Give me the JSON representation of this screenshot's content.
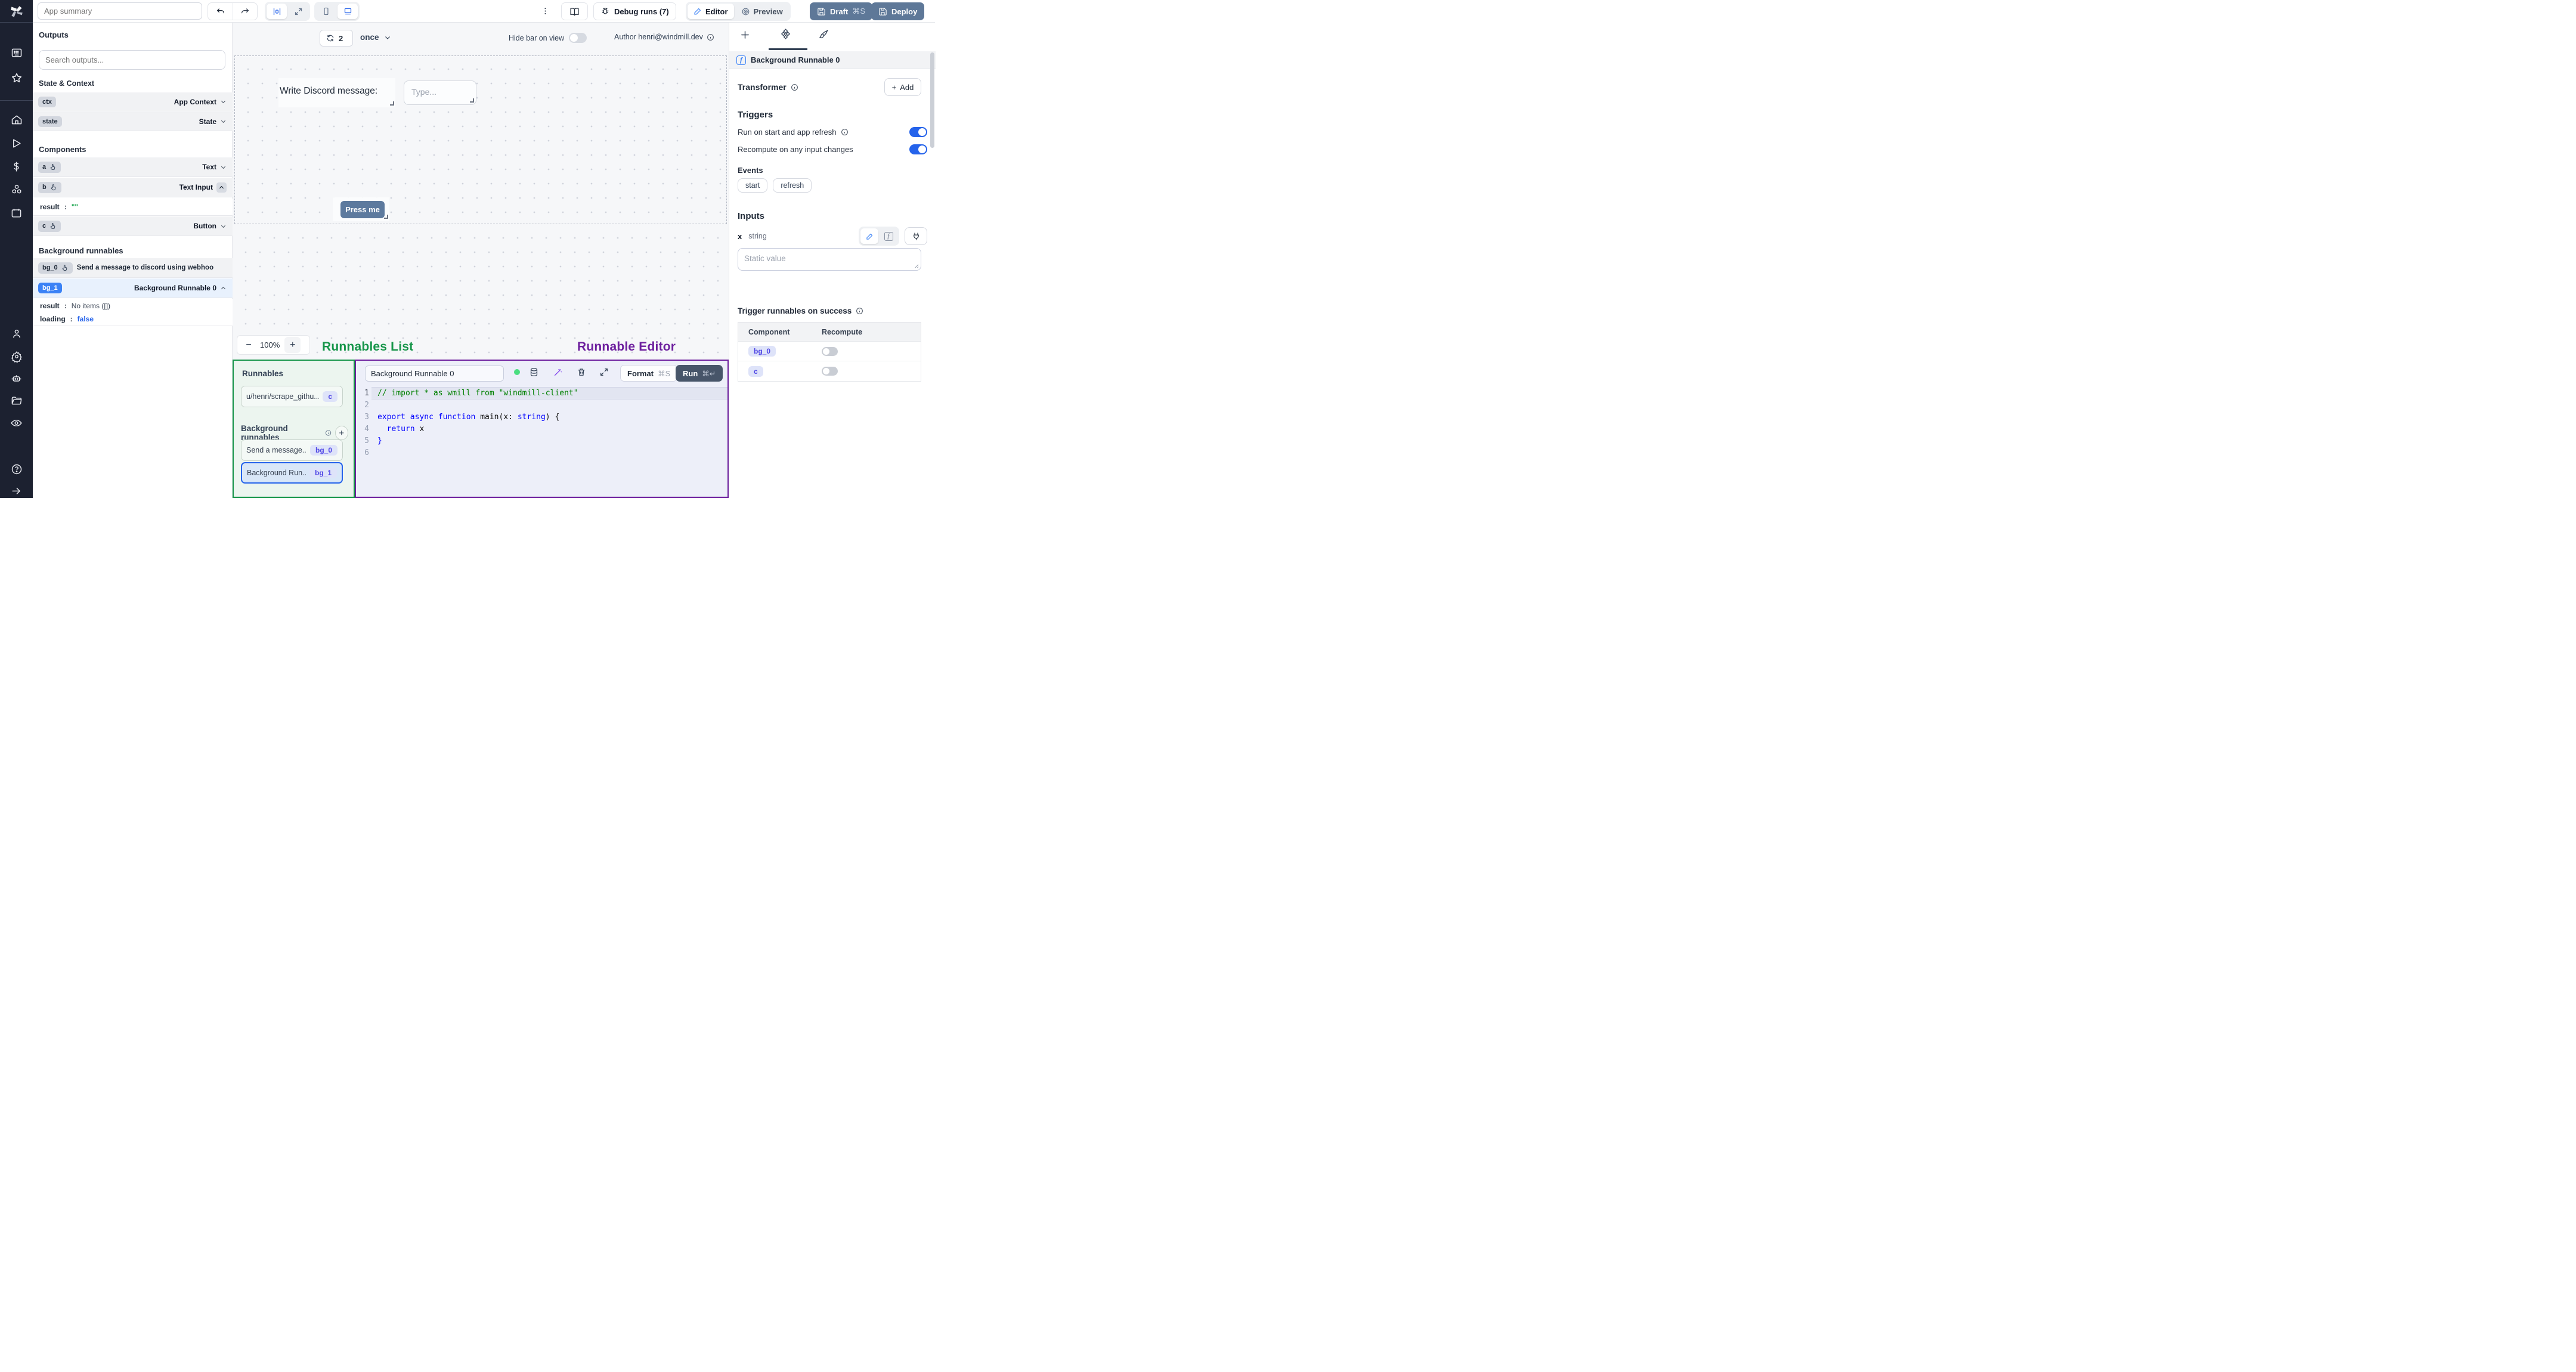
{
  "topbar": {
    "app_summary_placeholder": "App summary",
    "debug_runs_label": "Debug runs (7)",
    "editor_label": "Editor",
    "preview_label": "Preview",
    "draft_label": "Draft",
    "draft_shortcut": "⌘S",
    "deploy_label": "Deploy"
  },
  "outputs": {
    "title": "Outputs",
    "search_placeholder": "Search outputs...",
    "state_context_title": "State & Context",
    "components_title": "Components",
    "background_title": "Background runnables",
    "state_rows": [
      {
        "badge": "ctx",
        "label": "App Context"
      },
      {
        "badge": "state",
        "label": "State"
      }
    ],
    "component_rows": [
      {
        "badge": "a",
        "label": "Text"
      },
      {
        "badge": "b",
        "label": "Text Input"
      },
      {
        "badge": "c",
        "label": "Button"
      }
    ],
    "b_result": {
      "key": "result",
      "sep": ":",
      "value": "\"\""
    },
    "bg_rows": [
      {
        "badge": "bg_0",
        "label": "Send a message to discord using webhoo"
      },
      {
        "badge": "bg_1",
        "label": "Background Runnable 0"
      }
    ],
    "bg1_result": {
      "key": "result",
      "sep": ":",
      "value": "No items ([])"
    },
    "bg1_loading": {
      "key": "loading",
      "sep": ":",
      "value": "false"
    }
  },
  "canvas": {
    "refresh_count": "2",
    "mode": "once",
    "hide_bar_label": "Hide bar on view",
    "author_label": "Author henri@windmill.dev",
    "text_component": "Write Discord message:",
    "input_placeholder": "Type...",
    "button_label": "Press me",
    "zoom_minus": "−",
    "zoom_value": "100%",
    "zoom_plus": "+",
    "annotation_left": "Runnables List",
    "annotation_right": "Runnable Editor"
  },
  "runnables": {
    "title": "Runnables",
    "items": [
      {
        "label": "u/henri/scrape_githu...",
        "badge": "c"
      }
    ],
    "background_title": "Background runnables",
    "bg_items": [
      {
        "label": "Send a message...",
        "badge": "bg_0"
      },
      {
        "label": "Background Run...",
        "badge": "bg_1"
      }
    ]
  },
  "editor": {
    "name_value": "Background Runnable 0",
    "format_label": "Format",
    "format_shortcut": "⌘S",
    "run_label": "Run",
    "run_shortcut": "⌘↵",
    "line_numbers": [
      "1",
      "2",
      "3",
      "4",
      "5",
      "6"
    ],
    "code": {
      "l1_comment": "// import * as wmill from \"windmill-client\"",
      "l3_kw": "export async function",
      "l3_name": " main(",
      "l3_arg": "x: ",
      "l3_type": "string",
      "l3_end": ") {",
      "l4_kw": "  return",
      "l4_rest": " x",
      "l5": "}"
    }
  },
  "right": {
    "header_title": "Background Runnable 0",
    "transformer_title": "Transformer",
    "add_plus": "+",
    "add_label": "Add",
    "triggers_title": "Triggers",
    "trigger_rows": [
      {
        "label": "Run on start and app refresh"
      },
      {
        "label": "Recompute on any input changes"
      }
    ],
    "events_title": "Events",
    "events": [
      {
        "label": "start"
      },
      {
        "label": "refresh"
      }
    ],
    "inputs_title": "Inputs",
    "input_name": "x",
    "input_type": "string",
    "static_placeholder": "Static value",
    "success_title": "Trigger runnables on success",
    "table": {
      "columns": [
        {
          "label": "Component"
        },
        {
          "label": "Recompute"
        }
      ],
      "rows": [
        {
          "badge": "bg_0"
        },
        {
          "badge": "c"
        }
      ]
    }
  },
  "colors": {
    "accent_blue": "#2563eb",
    "badge_blue": "#3b82f6",
    "slate_button": "#5e7898",
    "run_button": "#475569",
    "annotation_green": "#169549",
    "annotation_purple": "#6d1f9e",
    "code_comment": "#008000",
    "code_keyword": "#0000ff"
  }
}
